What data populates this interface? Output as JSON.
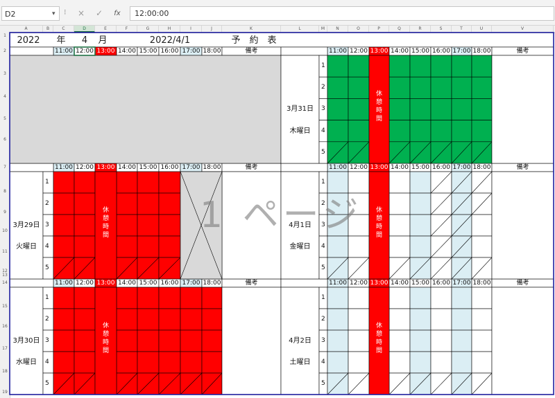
{
  "namebox": "D2",
  "formula": {
    "cancel_icon": "×",
    "confirm_icon": "✓",
    "fx_label": "fx",
    "value": "12:00:00"
  },
  "columns": [
    "A",
    "B",
    "C",
    "D",
    "E",
    "F",
    "G",
    "H",
    "I",
    "J",
    "K",
    "L",
    "M",
    "N",
    "O",
    "P",
    "Q",
    "R",
    "S",
    "T",
    "U",
    "V"
  ],
  "selected_column": "D",
  "rows": [
    "1",
    "2",
    "3",
    "4",
    "5",
    "6",
    "7",
    "8",
    "9",
    "10",
    "11",
    "12",
    "13",
    "14",
    "15",
    "16",
    "17",
    "18",
    "19"
  ],
  "header": {
    "year": "2022",
    "year_unit": "年",
    "month": "4",
    "month_unit": "月",
    "date": "2022/4/1",
    "title": "予　約　表"
  },
  "times": [
    "11:00",
    "12:00",
    "13:00",
    "14:00",
    "15:00",
    "16:00",
    "17:00",
    "18:00"
  ],
  "remarks_label": "備考",
  "slots": [
    "1",
    "2",
    "3",
    "4",
    "5"
  ],
  "break_label": "休憩時間",
  "days": {
    "mar29": {
      "date": "3月29日",
      "weekday": "火曜日"
    },
    "mar30": {
      "date": "3月30日",
      "weekday": "水曜日"
    },
    "mar31": {
      "date": "3月31日",
      "weekday": "木曜日"
    },
    "apr1": {
      "date": "4月1日",
      "weekday": "金曜日"
    },
    "apr2": {
      "date": "4月2日",
      "weekday": "土曜日"
    }
  },
  "watermark": "1 ページ",
  "colors": {
    "red": "#ff0000",
    "green": "#00b050",
    "lightblue": "#dbeef4",
    "gray": "#d9d9d9",
    "border": "#1f1f9f"
  }
}
